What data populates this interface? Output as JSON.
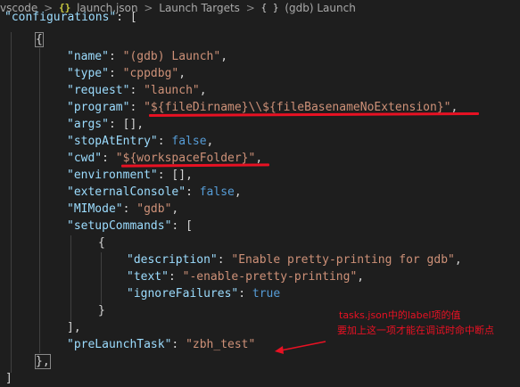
{
  "breadcrumb": {
    "items": [
      {
        "label": "vscode",
        "icon": ""
      },
      {
        "label": "launch.json",
        "icon": "json-icon"
      },
      {
        "label": "Launch Targets",
        "icon": ""
      },
      {
        "label": "(gdb) Launch",
        "icon": "braces-icon"
      }
    ],
    "separator": ">",
    "json_glyph": "{}",
    "braces_glyph": "{ }"
  },
  "code": {
    "l0": {
      "key": "\"configurations\"",
      "rest": ": ["
    },
    "l1": {
      "brace": "{"
    },
    "l2": {
      "key": "\"name\"",
      "colon": ": ",
      "value": "\"(gdb) Launch\"",
      "tail": ","
    },
    "l3": {
      "key": "\"type\"",
      "colon": ": ",
      "value": "\"cppdbg\"",
      "tail": ","
    },
    "l4": {
      "key": "\"request\"",
      "colon": ": ",
      "value": "\"launch\"",
      "tail": ","
    },
    "l5": {
      "key": "\"program\"",
      "colon": ": ",
      "value": "\"${fileDirname}\\\\${fileBasenameNoExtension}\"",
      "tail": ","
    },
    "l6": {
      "key": "\"args\"",
      "colon": ": ",
      "value": "[]",
      "tail": ","
    },
    "l7": {
      "key": "\"stopAtEntry\"",
      "colon": ": ",
      "value": "false",
      "tail": ","
    },
    "l8": {
      "key": "\"cwd\"",
      "colon": ": ",
      "value": "\"${workspaceFolder}\"",
      "tail": ","
    },
    "l9": {
      "key": "\"environment\"",
      "colon": ": ",
      "value": "[]",
      "tail": ","
    },
    "l10": {
      "key": "\"externalConsole\"",
      "colon": ": ",
      "value": "false",
      "tail": ","
    },
    "l11": {
      "key": "\"MIMode\"",
      "colon": ": ",
      "value": "\"gdb\"",
      "tail": ","
    },
    "l12": {
      "key": "\"setupCommands\"",
      "colon": ": ",
      "value": "["
    },
    "l13": {
      "brace": "{"
    },
    "l14": {
      "key": "\"description\"",
      "colon": ": ",
      "value": "\"Enable pretty-printing for gdb\"",
      "tail": ","
    },
    "l15": {
      "key": "\"text\"",
      "colon": ": ",
      "value": "\"-enable-pretty-printing\"",
      "tail": ","
    },
    "l16": {
      "key": "\"ignoreFailures\"",
      "colon": ": ",
      "value": "true"
    },
    "l17": {
      "brace": "}"
    },
    "l18": {
      "brace": "],"
    },
    "l19": {
      "key": "\"preLaunchTask\"",
      "colon": ": ",
      "value": "\"zbh_test\""
    },
    "l20": {
      "brace": "},"
    },
    "l21": {
      "brace": "]"
    }
  },
  "annotation": {
    "line1": "tasks.json中的label项的值",
    "line2": "要加上这一项才能在调试时命中断点",
    "color": "#e81123"
  },
  "colors": {
    "background": "#1e1e1e",
    "key": "#9cdcfe",
    "string": "#ce9178",
    "keyword": "#569cd6",
    "punctuation": "#d4d4d4",
    "markup": "#e81123"
  }
}
